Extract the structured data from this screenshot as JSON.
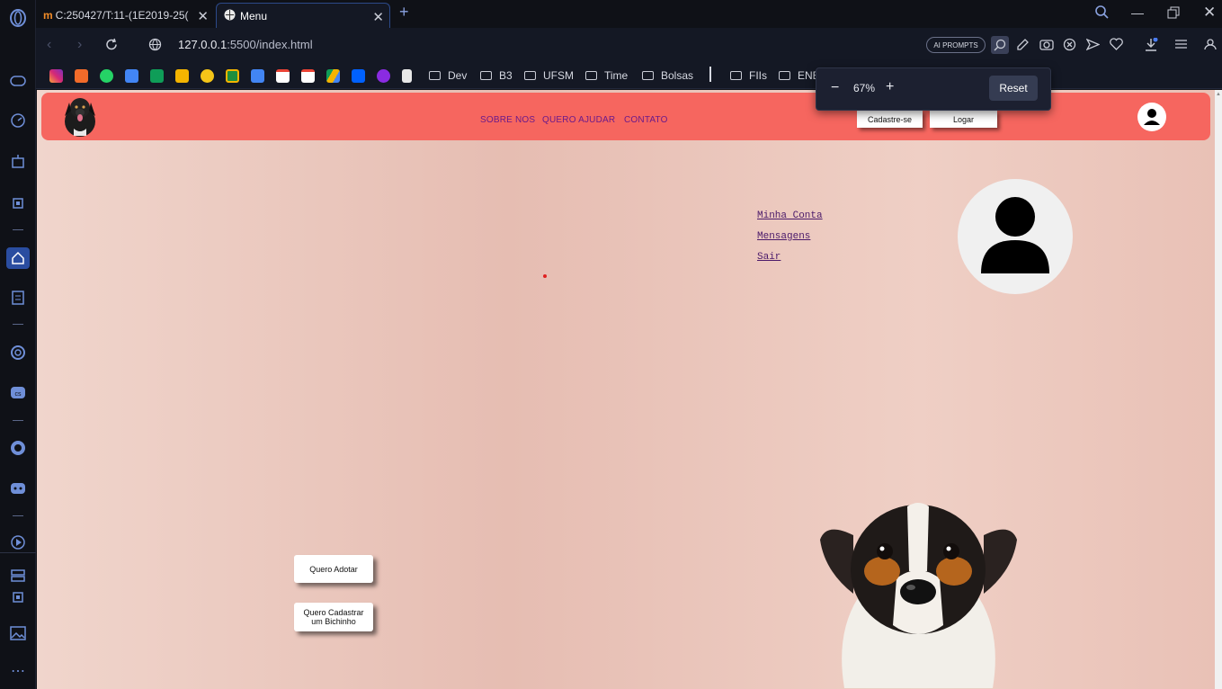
{
  "browser": {
    "tabs": [
      {
        "title": "C:250427/T:11-(1E2019-25(",
        "icon": "moodle-icon"
      },
      {
        "title": "Menu",
        "icon": "globe-icon"
      }
    ],
    "new_tab": "+",
    "url_host": "127.0.0.1",
    "url_rest": ":5500/index.html",
    "ai_prompts": "AI PROMPTS",
    "bookmarks": [
      "Dev",
      "B3",
      "UFSM",
      "Time",
      "Bolsas",
      "FIIs",
      "ENE"
    ],
    "zoom": {
      "minus": "−",
      "value": "67%",
      "plus": "+",
      "reset": "Reset"
    }
  },
  "site": {
    "nav": [
      "SOBRE NOS",
      "QUERO AJUDAR",
      "CONTATO"
    ],
    "signup_label": "Cadastre-se",
    "login_label": "Logar",
    "user_menu": [
      "Minha Conta",
      "Mensagens",
      "Sair"
    ],
    "adopt_button": "Quero Adotar",
    "register_pet_button": "Quero Cadastrar um Bichinho"
  },
  "colors": {
    "header": "#f6665f",
    "accent": "#4a6fd0",
    "nav_link": "#6b1a8a"
  }
}
